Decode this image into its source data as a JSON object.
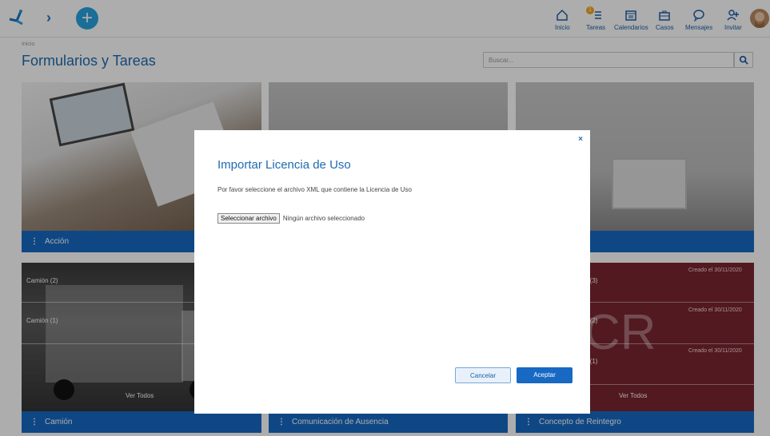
{
  "app": {
    "colors": {
      "primary": "#1769c4",
      "accent": "#29a3e0",
      "badge": "#f5a623",
      "case_card": "#7a2530"
    }
  },
  "nav": {
    "items": [
      {
        "label": "Inicio",
        "icon": "home-icon"
      },
      {
        "label": "Tareas",
        "icon": "tasks-icon",
        "badge": "1"
      },
      {
        "label": "Calendarios",
        "icon": "calendar-icon"
      },
      {
        "label": "Casos",
        "icon": "briefcase-icon"
      },
      {
        "label": "Mensajes",
        "icon": "message-icon"
      },
      {
        "label": "Invitar",
        "icon": "add-user-icon"
      }
    ]
  },
  "breadcrumb": "Inicio",
  "page_title": "Formularios y Tareas",
  "search": {
    "placeholder": "Buscar..."
  },
  "cards": [
    {
      "title": "Acción"
    },
    {
      "title": "Camión",
      "rows": [
        "Camión (2)",
        "Camión (1)"
      ],
      "view_all": "Ver Todos"
    },
    {
      "title": "Comunicación de Ausencia"
    },
    {
      "title": "Concepto de Reintegro",
      "rows": [
        "o (3)",
        "o (2)",
        "o (1)"
      ],
      "created": [
        "Creado el 30/11/2020",
        "Creado el 30/11/2020",
        "Creado el 30/11/2020"
      ],
      "initials": "CR",
      "view_all": "Ver Todos"
    }
  ],
  "modal": {
    "close": "×",
    "title": "Importar Licencia de Uso",
    "text": "Por favor seleccione el archivo XML que contiene la Licencia de Uso",
    "file_button": "Seleccionar archivo",
    "file_status": "Ningún archivo seleccionado",
    "cancel": "Cancelar",
    "accept": "Aceptar"
  }
}
